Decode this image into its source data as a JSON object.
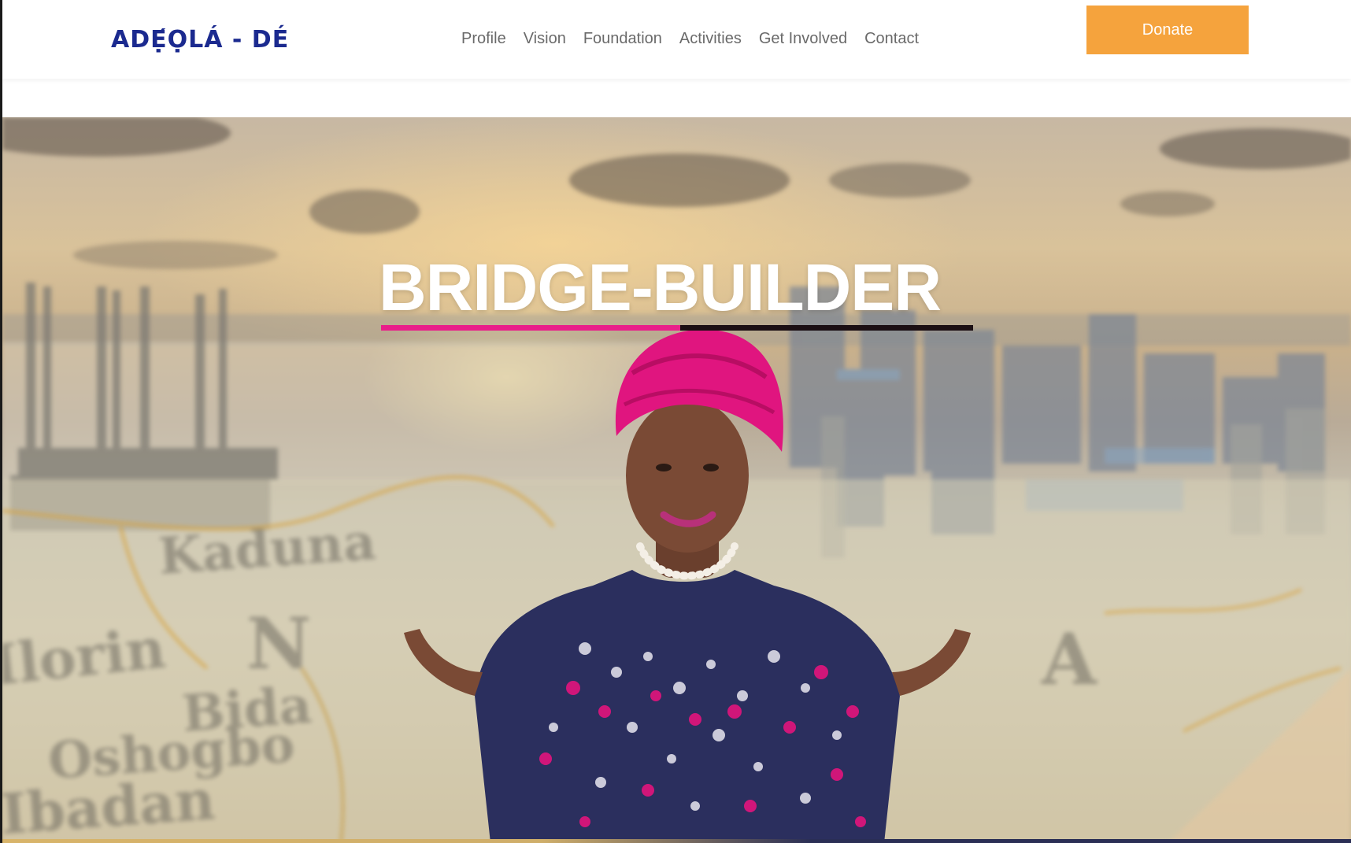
{
  "header": {
    "logo_text": "ADẸ́ỌLÁ - DÉ",
    "nav": [
      "Profile",
      "Vision",
      "Foundation",
      "Activities",
      "Get Involved",
      "Contact"
    ],
    "donate_label": "Donate"
  },
  "hero": {
    "title": "BRIDGE-BUILDER",
    "background_description_words": [
      "Kaduna",
      "N",
      "A",
      "Ilorin",
      "Bida",
      "Oshogbo",
      "Ibadan"
    ]
  },
  "colors": {
    "brand_blue": "#1b2a8f",
    "donate_orange": "#f5a33d",
    "underline_pink": "#e91e8a",
    "underline_dark": "#1b0f14"
  }
}
